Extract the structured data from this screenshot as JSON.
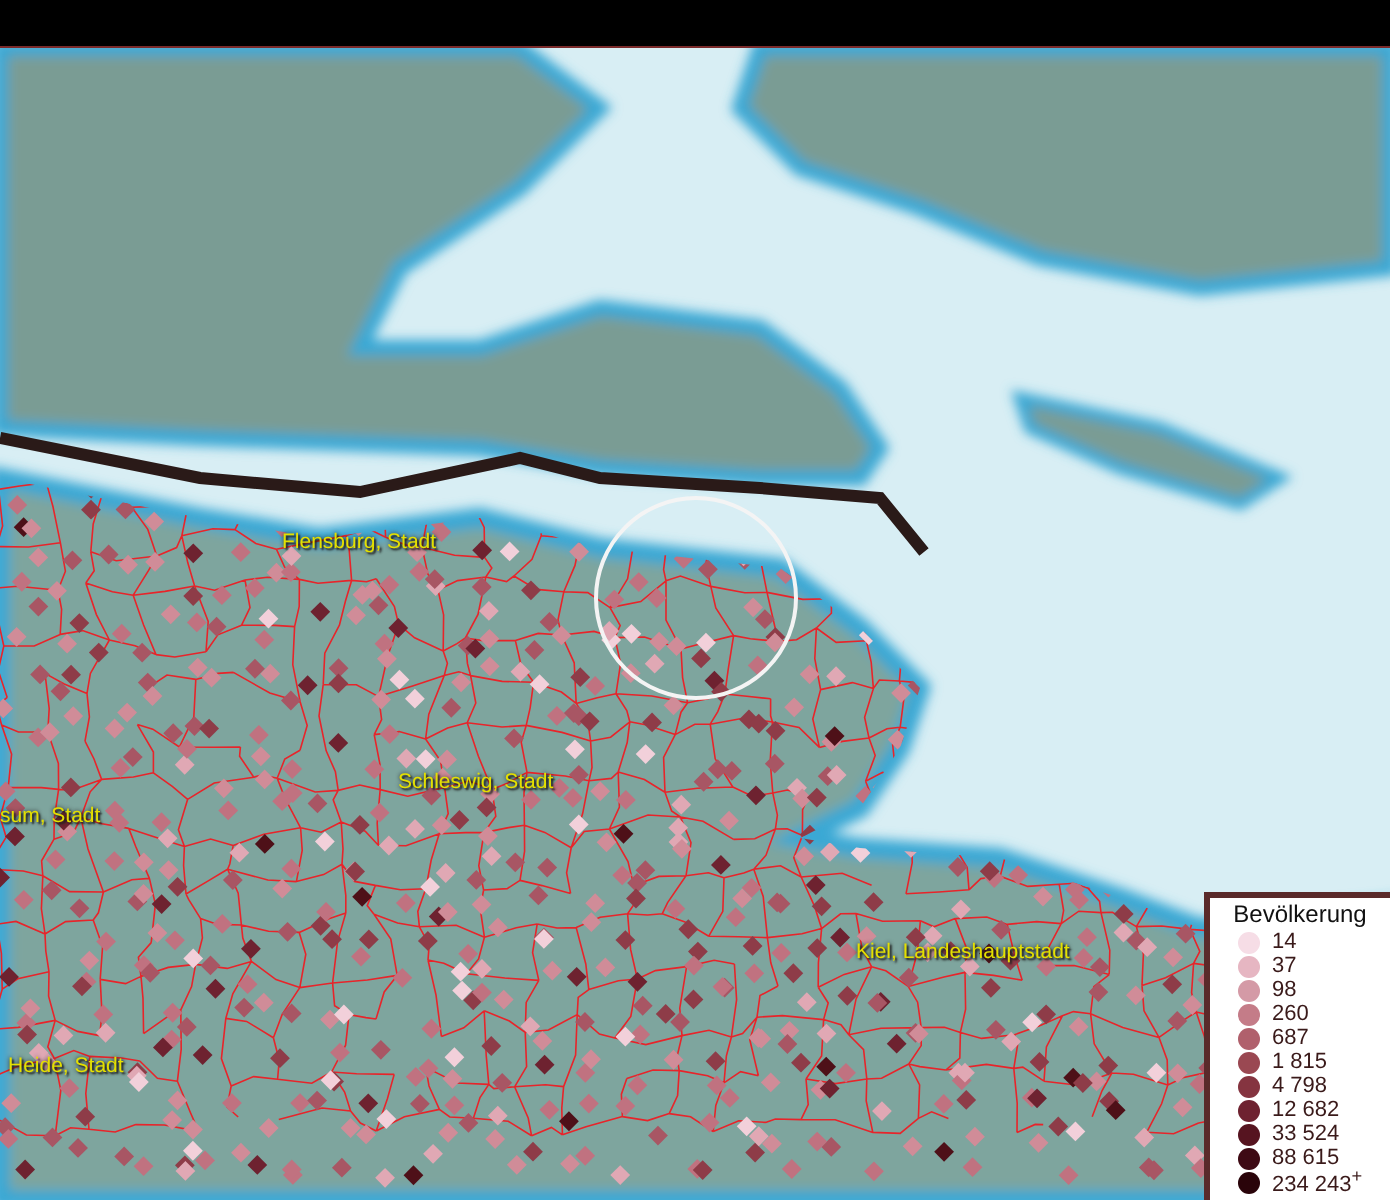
{
  "map": {
    "places": [
      {
        "name": "Flensburg, Stadt"
      },
      {
        "name": "Schleswig, Stadt"
      },
      {
        "name": "sum, Stadt"
      },
      {
        "name": "Kiel, Landeshauptstadt"
      },
      {
        "name": "Heide, Stadt"
      }
    ]
  },
  "legend": {
    "title": "Bevölkerung",
    "items": [
      {
        "label": "14",
        "color": "#f6dde6"
      },
      {
        "label": "37",
        "color": "#e6b6c2"
      },
      {
        "label": "98",
        "color": "#d49aa6"
      },
      {
        "label": "260",
        "color": "#c47c88"
      },
      {
        "label": "687",
        "color": "#b0606c"
      },
      {
        "label": "1 815",
        "color": "#9a4852"
      },
      {
        "label": "4 798",
        "color": "#853440"
      },
      {
        "label": "12 682",
        "color": "#6e2230"
      },
      {
        "label": "33 524",
        "color": "#561420"
      },
      {
        "label": "88 615",
        "color": "#3e0a14"
      },
      {
        "label": "234 243$^{+}$",
        "color": "#2a040a"
      }
    ]
  }
}
